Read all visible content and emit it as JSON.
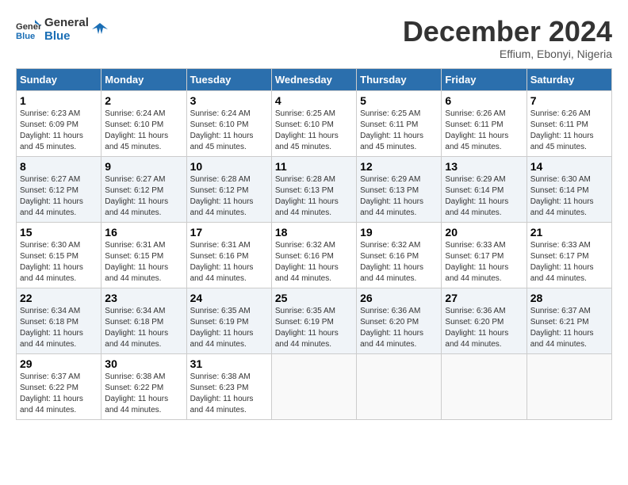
{
  "logo": {
    "line1": "General",
    "line2": "Blue"
  },
  "title": "December 2024",
  "subtitle": "Effium, Ebonyi, Nigeria",
  "days_of_week": [
    "Sunday",
    "Monday",
    "Tuesday",
    "Wednesday",
    "Thursday",
    "Friday",
    "Saturday"
  ],
  "weeks": [
    [
      {
        "day": 1,
        "sunrise": "6:23 AM",
        "sunset": "6:09 PM",
        "daylight": "11 hours and 45 minutes."
      },
      {
        "day": 2,
        "sunrise": "6:24 AM",
        "sunset": "6:10 PM",
        "daylight": "11 hours and 45 minutes."
      },
      {
        "day": 3,
        "sunrise": "6:24 AM",
        "sunset": "6:10 PM",
        "daylight": "11 hours and 45 minutes."
      },
      {
        "day": 4,
        "sunrise": "6:25 AM",
        "sunset": "6:10 PM",
        "daylight": "11 hours and 45 minutes."
      },
      {
        "day": 5,
        "sunrise": "6:25 AM",
        "sunset": "6:11 PM",
        "daylight": "11 hours and 45 minutes."
      },
      {
        "day": 6,
        "sunrise": "6:26 AM",
        "sunset": "6:11 PM",
        "daylight": "11 hours and 45 minutes."
      },
      {
        "day": 7,
        "sunrise": "6:26 AM",
        "sunset": "6:11 PM",
        "daylight": "11 hours and 45 minutes."
      }
    ],
    [
      {
        "day": 8,
        "sunrise": "6:27 AM",
        "sunset": "6:12 PM",
        "daylight": "11 hours and 44 minutes."
      },
      {
        "day": 9,
        "sunrise": "6:27 AM",
        "sunset": "6:12 PM",
        "daylight": "11 hours and 44 minutes."
      },
      {
        "day": 10,
        "sunrise": "6:28 AM",
        "sunset": "6:12 PM",
        "daylight": "11 hours and 44 minutes."
      },
      {
        "day": 11,
        "sunrise": "6:28 AM",
        "sunset": "6:13 PM",
        "daylight": "11 hours and 44 minutes."
      },
      {
        "day": 12,
        "sunrise": "6:29 AM",
        "sunset": "6:13 PM",
        "daylight": "11 hours and 44 minutes."
      },
      {
        "day": 13,
        "sunrise": "6:29 AM",
        "sunset": "6:14 PM",
        "daylight": "11 hours and 44 minutes."
      },
      {
        "day": 14,
        "sunrise": "6:30 AM",
        "sunset": "6:14 PM",
        "daylight": "11 hours and 44 minutes."
      }
    ],
    [
      {
        "day": 15,
        "sunrise": "6:30 AM",
        "sunset": "6:15 PM",
        "daylight": "11 hours and 44 minutes."
      },
      {
        "day": 16,
        "sunrise": "6:31 AM",
        "sunset": "6:15 PM",
        "daylight": "11 hours and 44 minutes."
      },
      {
        "day": 17,
        "sunrise": "6:31 AM",
        "sunset": "6:16 PM",
        "daylight": "11 hours and 44 minutes."
      },
      {
        "day": 18,
        "sunrise": "6:32 AM",
        "sunset": "6:16 PM",
        "daylight": "11 hours and 44 minutes."
      },
      {
        "day": 19,
        "sunrise": "6:32 AM",
        "sunset": "6:16 PM",
        "daylight": "11 hours and 44 minutes."
      },
      {
        "day": 20,
        "sunrise": "6:33 AM",
        "sunset": "6:17 PM",
        "daylight": "11 hours and 44 minutes."
      },
      {
        "day": 21,
        "sunrise": "6:33 AM",
        "sunset": "6:17 PM",
        "daylight": "11 hours and 44 minutes."
      }
    ],
    [
      {
        "day": 22,
        "sunrise": "6:34 AM",
        "sunset": "6:18 PM",
        "daylight": "11 hours and 44 minutes."
      },
      {
        "day": 23,
        "sunrise": "6:34 AM",
        "sunset": "6:18 PM",
        "daylight": "11 hours and 44 minutes."
      },
      {
        "day": 24,
        "sunrise": "6:35 AM",
        "sunset": "6:19 PM",
        "daylight": "11 hours and 44 minutes."
      },
      {
        "day": 25,
        "sunrise": "6:35 AM",
        "sunset": "6:19 PM",
        "daylight": "11 hours and 44 minutes."
      },
      {
        "day": 26,
        "sunrise": "6:36 AM",
        "sunset": "6:20 PM",
        "daylight": "11 hours and 44 minutes."
      },
      {
        "day": 27,
        "sunrise": "6:36 AM",
        "sunset": "6:20 PM",
        "daylight": "11 hours and 44 minutes."
      },
      {
        "day": 28,
        "sunrise": "6:37 AM",
        "sunset": "6:21 PM",
        "daylight": "11 hours and 44 minutes."
      }
    ],
    [
      {
        "day": 29,
        "sunrise": "6:37 AM",
        "sunset": "6:22 PM",
        "daylight": "11 hours and 44 minutes."
      },
      {
        "day": 30,
        "sunrise": "6:38 AM",
        "sunset": "6:22 PM",
        "daylight": "11 hours and 44 minutes."
      },
      {
        "day": 31,
        "sunrise": "6:38 AM",
        "sunset": "6:23 PM",
        "daylight": "11 hours and 44 minutes."
      },
      null,
      null,
      null,
      null
    ]
  ]
}
